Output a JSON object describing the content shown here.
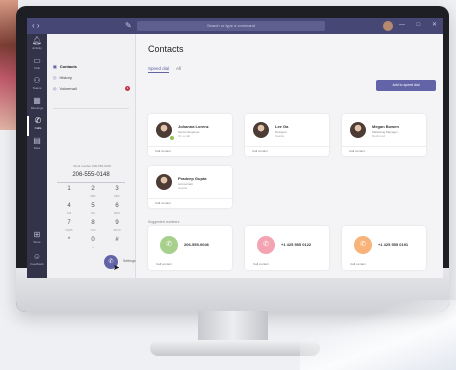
{
  "window": {
    "search_placeholder": "Search or type a command"
  },
  "appbar": [
    {
      "label": "Activity",
      "icon": "bell-icon"
    },
    {
      "label": "Chat",
      "icon": "chat-icon"
    },
    {
      "label": "Teams",
      "icon": "teams-icon"
    },
    {
      "label": "Meetings",
      "icon": "calendar-icon"
    },
    {
      "label": "Calls",
      "icon": "phone-icon",
      "active": true
    },
    {
      "label": "Files",
      "icon": "file-icon"
    },
    {
      "label": "Store",
      "icon": "store-icon"
    },
    {
      "label": "Feedback",
      "icon": "feedback-icon"
    }
  ],
  "calls_pane": {
    "items": [
      {
        "label": "Contacts",
        "icon": "contacts-icon"
      },
      {
        "label": "History",
        "icon": "history-icon"
      },
      {
        "label": "Voicemail",
        "icon": "voicemail-icon",
        "badge": "1"
      }
    ],
    "work_number_label": "Work number 206-555-0108",
    "dial_value": "206-555-0148",
    "keys": [
      {
        "d": "1",
        "s": ""
      },
      {
        "d": "2",
        "s": "ABC"
      },
      {
        "d": "3",
        "s": "DEF"
      },
      {
        "d": "4",
        "s": "GHI"
      },
      {
        "d": "5",
        "s": "JKL"
      },
      {
        "d": "6",
        "s": "MNO"
      },
      {
        "d": "7",
        "s": "PQRS"
      },
      {
        "d": "8",
        "s": "TUV"
      },
      {
        "d": "9",
        "s": "WXYZ"
      },
      {
        "d": "*",
        "s": ""
      },
      {
        "d": "0",
        "s": "+"
      },
      {
        "d": "#",
        "s": ""
      }
    ],
    "settings_label": "Settings"
  },
  "main": {
    "title": "Contacts",
    "tabs": [
      "Speed dial",
      "All"
    ],
    "add_button": "Add to speed dial",
    "contacts": [
      {
        "name": "Johanna Lorenz",
        "title": "Senior Engineer",
        "location": "On a call",
        "action": "Call contact"
      },
      {
        "name": "Lee Ga",
        "title": "Designer",
        "location": "Seattle",
        "action": "Call contact"
      },
      {
        "name": "Megan Bowen",
        "title": "Marketing Manager",
        "location": "Redmond",
        "action": "Call contact"
      },
      {
        "name": "Pradeep Gupta",
        "title": "Accountant",
        "location": "Seattle",
        "action": "Call contact"
      }
    ],
    "numbers_label": "Suggested numbers",
    "numbers": [
      {
        "number": "206-555-0046",
        "color": "#a8d08d",
        "action": "Call contact"
      },
      {
        "number": "+1 425 555 0122",
        "color": "#f4a3b2",
        "action": "Call contact"
      },
      {
        "number": "+1 425 555 0191",
        "color": "#f7b37a",
        "action": "Call contact"
      }
    ]
  }
}
